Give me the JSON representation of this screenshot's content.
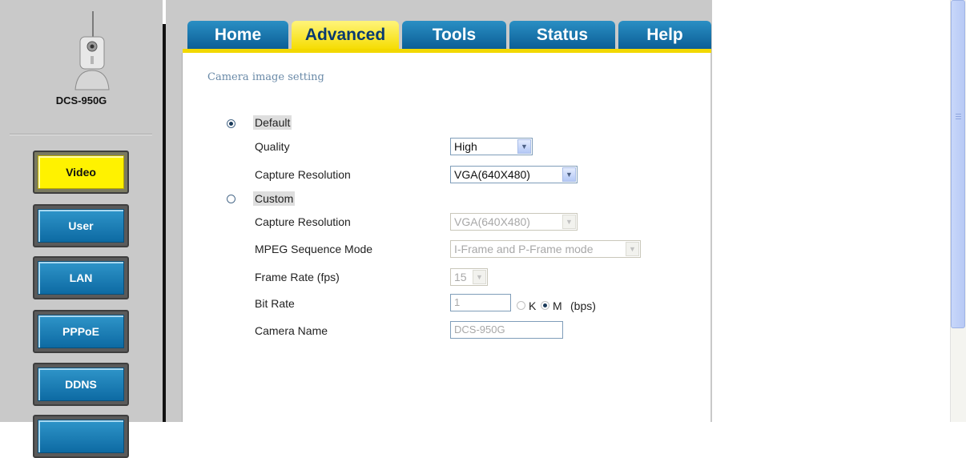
{
  "model": "DCS-950G",
  "nav": {
    "tabs": [
      {
        "label": "Home",
        "active": false
      },
      {
        "label": "Advanced",
        "active": true
      },
      {
        "label": "Tools",
        "active": false
      },
      {
        "label": "Status",
        "active": false
      },
      {
        "label": "Help",
        "active": false
      }
    ]
  },
  "sidebar": {
    "items": [
      {
        "label": "Video",
        "active": true
      },
      {
        "label": "User",
        "active": false
      },
      {
        "label": "LAN",
        "active": false
      },
      {
        "label": "PPPoE",
        "active": false
      },
      {
        "label": "DDNS",
        "active": false
      }
    ]
  },
  "section_title": "Camera image setting",
  "form": {
    "default_label": "Default",
    "default_selected": true,
    "quality_label": "Quality",
    "quality_value": "High",
    "capture_resolution_label": "Capture Resolution",
    "capture_resolution_value": "VGA(640X480)",
    "custom_label": "Custom",
    "custom_selected": false,
    "custom_capture_resolution_label": "Capture Resolution",
    "custom_capture_resolution_value": "VGA(640X480)",
    "mpeg_label": "MPEG Sequence Mode",
    "mpeg_value": "I-Frame and P-Frame mode",
    "frame_rate_label": "Frame Rate (fps)",
    "frame_rate_value": "15",
    "bit_rate_label": "Bit Rate",
    "bit_rate_value": "1",
    "bit_rate_k": "K",
    "bit_rate_m": "M",
    "bit_rate_unit": "(bps)",
    "bit_rate_unit_selected": "M",
    "camera_name_label": "Camera Name",
    "camera_name_value": "DCS-950G"
  },
  "colors": {
    "tab_blue": "#0b5d95",
    "tab_active_yellow": "#f5dc00",
    "sidebar_active": "#fff200",
    "sidebar_button": "#1a7bb5",
    "background_gray": "#c9c9c9"
  }
}
